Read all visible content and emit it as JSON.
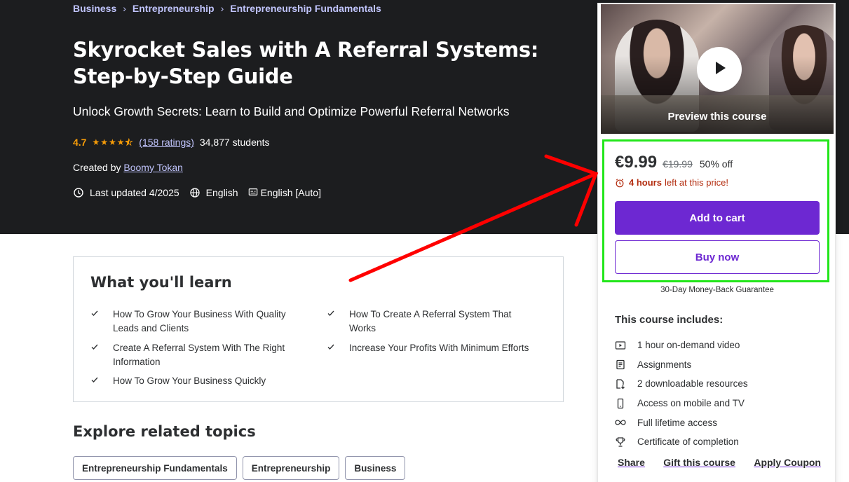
{
  "breadcrumb": [
    "Business",
    "Entrepreneurship",
    "Entrepreneurship Fundamentals"
  ],
  "course": {
    "title": "Skyrocket Sales with A Referral Systems: Step-by-Step Guide",
    "subtitle": "Unlock Growth Secrets: Learn to Build and Optimize Powerful Referral Networks",
    "rating": "4.7",
    "rating_stars": 4.5,
    "ratings_count": "(158 ratings)",
    "students": "34,877 students",
    "created_by_label": "Created by",
    "author": "Boomy Tokan",
    "last_updated": "Last updated 4/2025",
    "language": "English",
    "captions": "English [Auto]"
  },
  "card": {
    "preview_label": "Preview this course",
    "price": "€9.99",
    "old_price": "€19.99",
    "discount": "50% off",
    "timer_bold": "4 hours",
    "timer_rest": "left at this price!",
    "add_to_cart": "Add to cart",
    "buy_now": "Buy now",
    "guarantee": "30-Day Money-Back Guarantee",
    "includes_title": "This course includes:",
    "includes": [
      {
        "icon": "video-icon",
        "text": "1 hour on-demand video"
      },
      {
        "icon": "assignment-icon",
        "text": "Assignments"
      },
      {
        "icon": "download-icon",
        "text": "2 downloadable resources"
      },
      {
        "icon": "mobile-icon",
        "text": "Access on mobile and TV"
      },
      {
        "icon": "infinity-icon",
        "text": "Full lifetime access"
      },
      {
        "icon": "trophy-icon",
        "text": "Certificate of completion"
      }
    ],
    "links": {
      "share": "Share",
      "gift": "Gift this course",
      "coupon": "Apply Coupon"
    }
  },
  "learn": {
    "title": "What you'll learn",
    "items": [
      "How To Grow Your Business With Quality Leads and Clients",
      "How To Create A Referral System That Works",
      "Create A Referral System With The Right Information",
      "Increase Your Profits With Minimum Efforts",
      "How To Grow Your Business Quickly"
    ]
  },
  "related": {
    "title": "Explore related topics",
    "topics": [
      "Entrepreneurship Fundamentals",
      "Entrepreneurship",
      "Business"
    ]
  },
  "colors": {
    "hero_bg": "#1c1d1f",
    "accent": "#6d28d2",
    "link": "#c0c4fc",
    "star": "#f69c08",
    "timer": "#b32d0f",
    "highlight": "#22e61a",
    "arrow": "#ff0000"
  }
}
